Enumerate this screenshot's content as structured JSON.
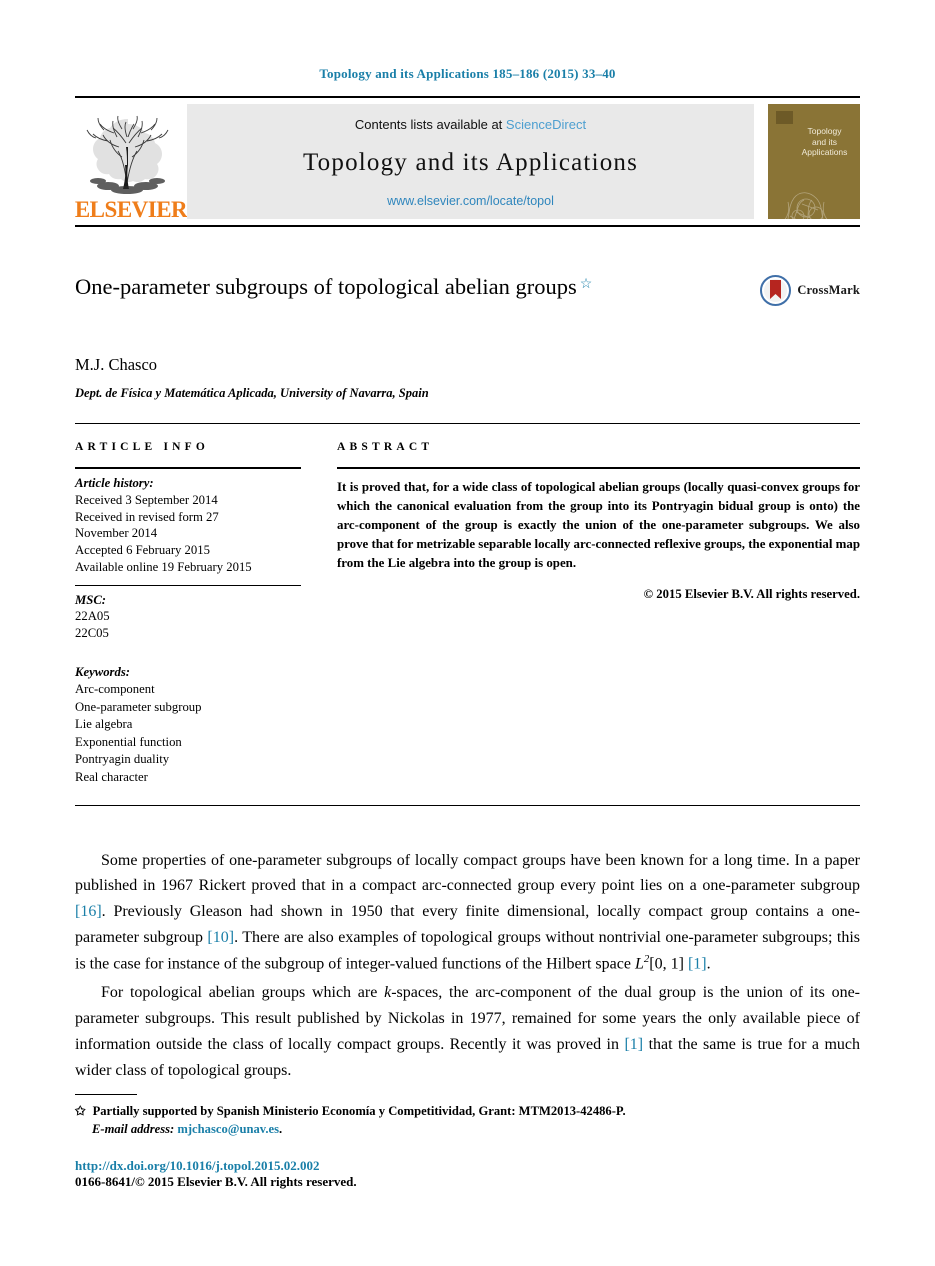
{
  "running_head": "Topology and its Applications 185–186 (2015) 33–40",
  "masthead": {
    "publisher_wordmark": "ELSEVIER",
    "contents_prefix": "Contents lists available at ",
    "sciencedirect": "ScienceDirect",
    "journal_name": "Topology and its Applications",
    "journal_url": "www.elsevier.com/locate/topol",
    "cover_title_line1": "Topology",
    "cover_title_line2": "and its",
    "cover_title_line3": "Applications"
  },
  "article": {
    "title": "One-parameter subgroups of topological abelian groups",
    "title_footnote_marker": "☆",
    "author": "M.J. Chasco",
    "affiliation": "Dept. de Física y Matemática Aplicada, University of Navarra, Spain",
    "crossmark_label": "CrossMark"
  },
  "info": {
    "heading": "ARTICLE INFO",
    "history_label": "Article history:",
    "history": [
      "Received 3 September 2014",
      "Received in revised form 27",
      "November 2014",
      "Accepted 6 February 2015",
      "Available online 19 February 2015"
    ],
    "msc_label": "MSC:",
    "msc": [
      "22A05",
      "22C05"
    ],
    "keywords_label": "Keywords:",
    "keywords": [
      "Arc-component",
      "One-parameter subgroup",
      "Lie algebra",
      "Exponential function",
      "Pontryagin duality",
      "Real character"
    ]
  },
  "abstract": {
    "heading": "ABSTRACT",
    "text": "It is proved that, for a wide class of topological abelian groups (locally quasi-convex groups for which the canonical evaluation from the group into its Pontryagin bidual group is onto) the arc-component of the group is exactly the union of the one-parameter subgroups. We also prove that for metrizable separable locally arc-connected reflexive groups, the exponential map from the Lie algebra into the group is open.",
    "copyright": "© 2015 Elsevier B.V. All rights reserved."
  },
  "body": {
    "para1_a": "Some properties of one-parameter subgroups of locally compact groups have been known for a long time. In a paper published in 1967 Rickert proved that in a compact arc-connected group every point lies on a one-parameter subgroup ",
    "para1_cite1": "[16]",
    "para1_b": ". Previously Gleason had shown in 1950 that every finite dimensional, locally compact group contains a one-parameter subgroup ",
    "para1_cite2": "[10]",
    "para1_c": ". There are also examples of topological groups without nontrivial one-parameter subgroups; this is the case for instance of the subgroup of integer-valued functions of the Hilbert space ",
    "para1_math": "L",
    "para1_math_sup": "2",
    "para1_math_tail": "[0, 1] ",
    "para1_cite3": "[1]",
    "para1_d": ".",
    "para2_a": "For topological abelian groups which are ",
    "para2_italic": "k",
    "para2_b": "-spaces, the arc-component of the dual group is the union of its one-parameter subgroups. This result published by Nickolas in 1977, remained for some years the only available piece of information outside the class of locally compact groups. Recently it was proved in ",
    "para2_cite": "[1]",
    "para2_c": " that the same is true for a much wider class of topological groups."
  },
  "footer": {
    "star": "✩",
    "funding": "Partially supported by Spanish Ministerio Economía y Competitividad, Grant: MTM2013-42486-P.",
    "email_label": "E-mail address:",
    "email": "mjchasco@unav.es",
    "email_period": ".",
    "doi": "http://dx.doi.org/10.1016/j.topol.2015.02.002",
    "issn": "0166-8641/© 2015 Elsevier B.V. All rights reserved."
  },
  "colors": {
    "link_blue": "#1a7fa8",
    "sciencedirect_blue": "#4d9fd0",
    "elsevier_orange": "#ef7d1a",
    "cover_olive": "#8a7436"
  }
}
